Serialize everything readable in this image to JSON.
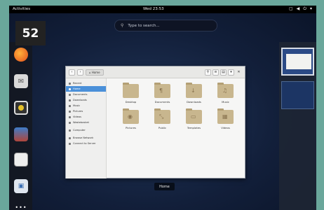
{
  "page_badge": "52",
  "topbar": {
    "activities": "Activities",
    "clock": "Wed 23:53",
    "tray_icons": [
      "screen-icon",
      "volume-icon",
      "power-icon",
      "chevron-down-icon"
    ]
  },
  "search": {
    "placeholder": "Type to search..."
  },
  "dash": {
    "apps": [
      "firefox-icon",
      "mail-icon",
      "speaker-icon",
      "photos-icon",
      "document-icon",
      "software-icon",
      "app-grid-icon"
    ]
  },
  "files_window": {
    "path": "Home",
    "sidebar": [
      {
        "label": "Recent",
        "active": false
      },
      {
        "label": "Home",
        "active": true
      },
      {
        "label": "Documents",
        "active": false
      },
      {
        "label": "Downloads",
        "active": false
      },
      {
        "label": "Music",
        "active": false
      },
      {
        "label": "Pictures",
        "active": false
      },
      {
        "label": "Videos",
        "active": false
      },
      {
        "label": "Wastebasket",
        "active": false
      },
      {
        "label": "Computer",
        "active": false
      },
      {
        "label": "Browse Network",
        "active": false
      },
      {
        "label": "Connect to Server",
        "active": false
      }
    ],
    "folders": [
      {
        "label": "Desktop",
        "emblem": ""
      },
      {
        "label": "Documents",
        "emblem": "¶"
      },
      {
        "label": "Downloads",
        "emblem": "↓"
      },
      {
        "label": "Music",
        "emblem": "♫"
      },
      {
        "label": "Pictures",
        "emblem": "◉"
      },
      {
        "label": "Public",
        "emblem": "⤡"
      },
      {
        "label": "Templates",
        "emblem": "▭"
      },
      {
        "label": "Videos",
        "emblem": "▦"
      }
    ]
  },
  "window_label": "Home"
}
